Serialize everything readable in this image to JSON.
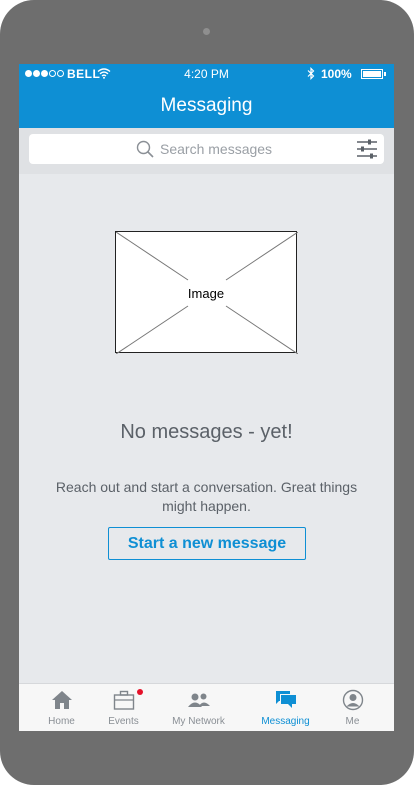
{
  "status_bar": {
    "carrier": "BELL",
    "time": "4:20 PM",
    "battery": "100%"
  },
  "header": {
    "title": "Messaging"
  },
  "search": {
    "placeholder": "Search messages"
  },
  "empty_state": {
    "image_label": "Image",
    "title": "No messages - yet!",
    "description": "Reach out and start a conversation. Great things might happen.",
    "cta_label": "Start a new message"
  },
  "tabs": [
    {
      "label": "Home",
      "icon": "home-icon"
    },
    {
      "label": "Events",
      "icon": "briefcase-icon",
      "badge": true
    },
    {
      "label": "My Network",
      "icon": "people-icon"
    },
    {
      "label": "Messaging",
      "icon": "chat-icon",
      "active": true
    },
    {
      "label": "Me",
      "icon": "profile-icon"
    }
  ],
  "colors": {
    "brand": "#0e8fd4",
    "badge": "#e5112a",
    "background": "#e7e9ec"
  }
}
